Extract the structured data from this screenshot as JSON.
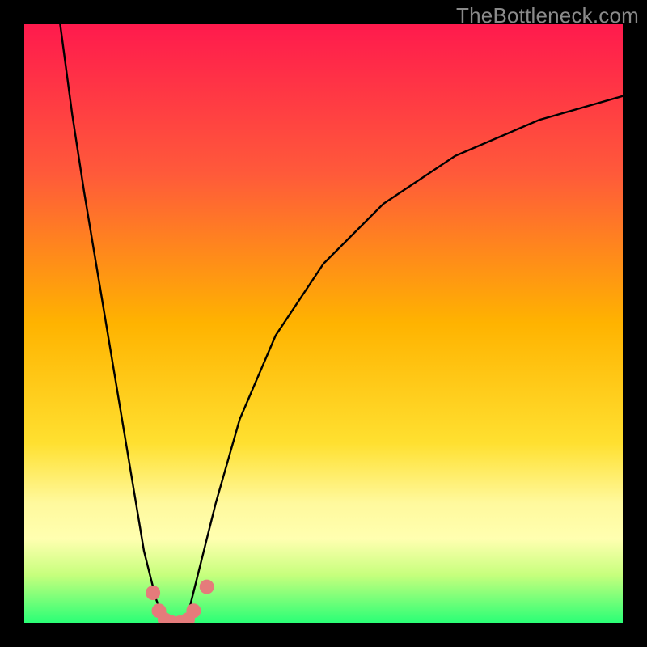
{
  "watermark": {
    "text": "TheBottleneck.com"
  },
  "chart_data": {
    "type": "line",
    "title": "",
    "xlabel": "",
    "ylabel": "",
    "xlim": [
      0,
      100
    ],
    "ylim": [
      0,
      100
    ],
    "grid": false,
    "legend": false,
    "background_gradient": {
      "stops": [
        {
          "pct": 0,
          "color": "#ff1a4d"
        },
        {
          "pct": 25,
          "color": "#ff5a3a"
        },
        {
          "pct": 50,
          "color": "#ffb300"
        },
        {
          "pct": 70,
          "color": "#ffe030"
        },
        {
          "pct": 80,
          "color": "#fff99d"
        },
        {
          "pct": 86,
          "color": "#ffffb0"
        },
        {
          "pct": 92,
          "color": "#c7ff7d"
        },
        {
          "pct": 100,
          "color": "#2aff76"
        }
      ]
    },
    "series": [
      {
        "name": "left-branch",
        "color": "#000000",
        "x": [
          6,
          8,
          10,
          12,
          14,
          16,
          18,
          20,
          22,
          23.5
        ],
        "y": [
          100,
          85,
          72,
          60,
          48,
          36,
          24,
          12,
          4,
          0
        ]
      },
      {
        "name": "right-branch",
        "color": "#000000",
        "x": [
          27,
          29,
          32,
          36,
          42,
          50,
          60,
          72,
          86,
          100
        ],
        "y": [
          0,
          8,
          20,
          34,
          48,
          60,
          70,
          78,
          84,
          88
        ]
      }
    ],
    "markers": {
      "name": "bottom-dots",
      "color": "#e57b7b",
      "points": [
        {
          "x": 21.5,
          "y": 5
        },
        {
          "x": 22.5,
          "y": 2
        },
        {
          "x": 23.5,
          "y": 0.5
        },
        {
          "x": 24.7,
          "y": 0
        },
        {
          "x": 26.0,
          "y": 0
        },
        {
          "x": 27.3,
          "y": 0.5
        },
        {
          "x": 28.3,
          "y": 2
        },
        {
          "x": 30.5,
          "y": 6
        }
      ],
      "radius_px": 9
    }
  }
}
